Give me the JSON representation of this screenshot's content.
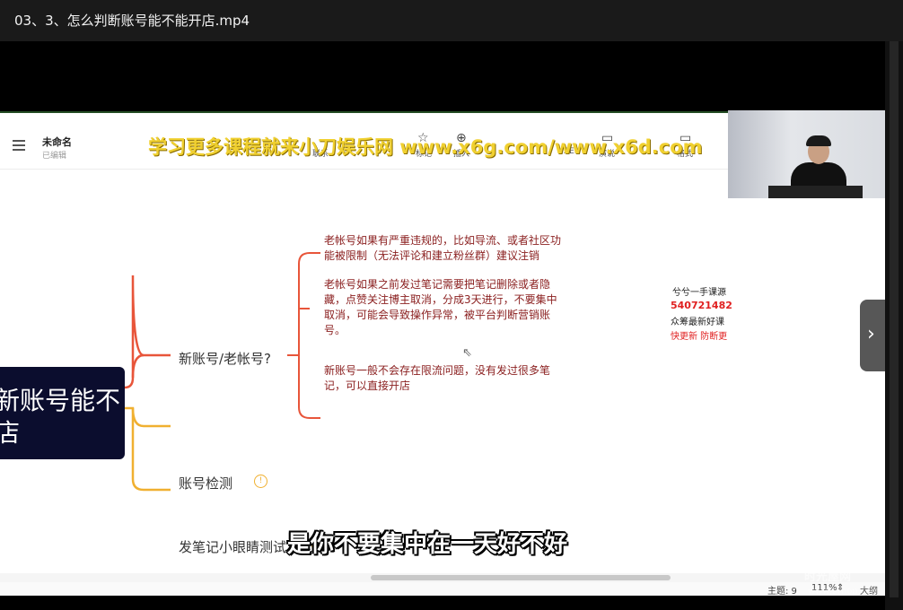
{
  "window": {
    "title": "03、3、怎么判断账号能不能开店.mp4"
  },
  "toolbar": {
    "doc_name": "未命名",
    "doc_status": "已编辑",
    "items": [
      "联系",
      "标记",
      "插入",
      "ZEN",
      "演说",
      "格式"
    ]
  },
  "watermark": "学习更多课程就来小刀娱乐网 www.x6g.com/www.x6d.com",
  "mindmap": {
    "central_line1": "新账号能不",
    "central_line2": "店",
    "branches": [
      "新账号/老帐号?",
      "账号检测",
      "发笔记小眼睛测试"
    ],
    "notes": [
      "老帐号如果有严重违规的，比如导流、或者社区功能被限制（无法评论和建立粉丝群）建议注销",
      "老帐号如果之前发过笔记需要把笔记删除或者隐藏，点赞关注博主取消，分成3天进行，不要集中取消，可能会导致操作异常，被平台判断营销账号。",
      "新账号一般不会存在限流问题，没有发过很多笔记，可以直接开店"
    ]
  },
  "side_ad": {
    "line1": "兮兮一手课源",
    "line2": "540721482",
    "line3": "众筹最新好课",
    "line4": "快更新 防断更"
  },
  "status_bar": {
    "topics": "主题: 9",
    "zoom": "111%",
    "view": "大纲"
  },
  "subtitle": "是你不要集中在一天好不好",
  "corner_watermark": {
    "name": "时光屋网",
    "url": "www.timop.com"
  },
  "colors": {
    "branch1": "#e8553a",
    "branch2": "#f0b030",
    "central": "#0b0d2e",
    "note": "#8b2020"
  }
}
